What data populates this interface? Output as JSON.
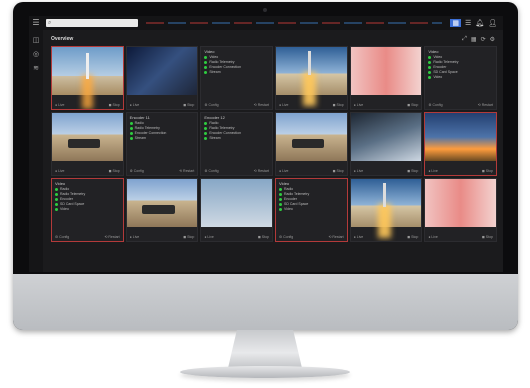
{
  "topbar": {
    "search_placeholder": "",
    "icons": [
      "settings-icon",
      "list-icon",
      "bell-icon",
      "user-icon"
    ]
  },
  "page": {
    "title": "Overview"
  },
  "tiles": [
    {
      "name": "",
      "kind": "video",
      "thumb": "t-rocket",
      "alert": true,
      "sub": "",
      "footer": [
        "● Live",
        "◼ Stop"
      ]
    },
    {
      "name": "",
      "kind": "video",
      "thumb": "t-suit",
      "alert": false,
      "sub": "",
      "footer": [
        "● Live",
        "◼ Stop"
      ]
    },
    {
      "name": "Video",
      "kind": "status",
      "alert": false,
      "status": [
        "Video",
        "Radio Telemetry",
        "Encoder Connection",
        "Stream"
      ],
      "footer": [
        "⚙ Config",
        "⟲ Restart"
      ]
    },
    {
      "name": "",
      "kind": "video",
      "thumb": "t-rocket2",
      "alert": false,
      "sub": "",
      "footer": [
        "● Live",
        "◼ Stop"
      ]
    },
    {
      "name": "",
      "kind": "video",
      "thumb": "t-runners",
      "alert": false,
      "sub": "",
      "footer": [
        "● Live",
        "◼ Stop"
      ]
    },
    {
      "name": "Video",
      "kind": "status",
      "alert": false,
      "status": [
        "Video",
        "Radio Telemetry",
        "Encoder",
        "SD Card Space",
        "Video"
      ],
      "footer": [
        "⚙ Config",
        "⟲ Restart"
      ]
    },
    {
      "name": "",
      "kind": "video",
      "thumb": "t-car",
      "alert": false,
      "sub": "",
      "footer": [
        "● Live",
        "◼ Stop"
      ]
    },
    {
      "name": "Encoder 11",
      "kind": "status",
      "alert": false,
      "status": [
        "Radio",
        "Radio Telemetry",
        "Encoder Connection",
        "Stream"
      ],
      "footer": [
        "⚙ Config",
        "⟲ Restart"
      ]
    },
    {
      "name": "Encoder 12",
      "kind": "status",
      "alert": false,
      "status": [
        "Radio",
        "Radio Telemetry",
        "Encoder Connection",
        "Stream"
      ],
      "footer": [
        "⚙ Config",
        "⟲ Restart"
      ]
    },
    {
      "name": "",
      "kind": "video",
      "thumb": "t-car",
      "alert": false,
      "sub": "",
      "footer": [
        "● Live",
        "◼ Stop"
      ]
    },
    {
      "name": "",
      "kind": "video",
      "thumb": "t-station",
      "alert": false,
      "sub": "",
      "footer": [
        "● Live",
        "◼ Stop"
      ]
    },
    {
      "name": "",
      "kind": "video",
      "thumb": "t-launch",
      "alert": true,
      "sub": "",
      "footer": [
        "● Live",
        "◼ Stop"
      ]
    },
    {
      "name": "Video",
      "kind": "status",
      "alert": true,
      "status": [
        "Radio",
        "Radio Telemetry",
        "Encoder",
        "SD Card Space",
        "Video"
      ],
      "footer": [
        "⚙ Config",
        "⟲ Restart"
      ]
    },
    {
      "name": "",
      "kind": "video",
      "thumb": "t-car",
      "alert": false,
      "sub": "",
      "footer": [
        "● Live",
        "◼ Stop"
      ]
    },
    {
      "name": "",
      "kind": "video",
      "thumb": "t-astro",
      "alert": false,
      "sub": "",
      "footer": [
        "● Live",
        "◼ Stop"
      ]
    },
    {
      "name": "Video",
      "kind": "status",
      "alert": true,
      "status": [
        "Radio",
        "Radio Telemetry",
        "Encoder",
        "SD Card Space",
        "Video"
      ],
      "footer": [
        "⚙ Config",
        "⟲ Restart"
      ]
    },
    {
      "name": "",
      "kind": "video",
      "thumb": "t-rocket2",
      "alert": false,
      "sub": "",
      "footer": [
        "● Live",
        "◼ Stop"
      ]
    },
    {
      "name": "",
      "kind": "video",
      "thumb": "t-runners",
      "alert": false,
      "sub": "",
      "footer": [
        "● Live",
        "◼ Stop"
      ]
    }
  ],
  "colors": {
    "alert": "#b33a3a",
    "ok": "#2ecc40",
    "accent": "#3c6fd6"
  }
}
